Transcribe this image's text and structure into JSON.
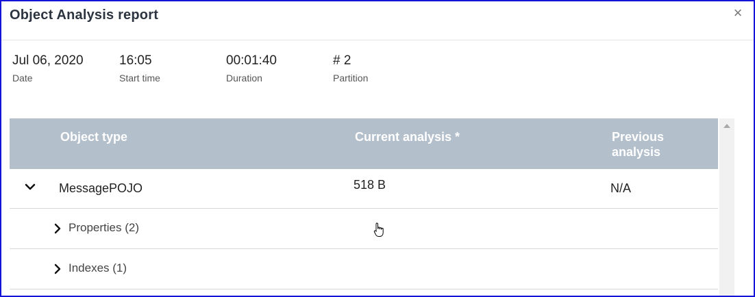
{
  "dialog": {
    "title": "Object Analysis report",
    "close_icon": "close-icon"
  },
  "stats": {
    "date": {
      "value": "Jul 06, 2020",
      "label": "Date"
    },
    "start_time": {
      "value": "16:05",
      "label": "Start time"
    },
    "duration": {
      "value": "00:01:40",
      "label": "Duration"
    },
    "partition": {
      "value": "# 2",
      "label": "Partition"
    }
  },
  "table": {
    "headers": {
      "object_type": "Object type",
      "current": "Current analysis *",
      "previous_line1": "Previous",
      "previous_line2": "analysis"
    },
    "rows": [
      {
        "object_type": "MessagePOJO",
        "current": "518 B",
        "previous": "N/A",
        "expanded": true
      }
    ],
    "sub_rows": [
      {
        "label": "Properties (2)"
      },
      {
        "label": "Indexes (1)"
      }
    ]
  },
  "colors": {
    "header_bg": "#b3bfcb",
    "frame_border": "#1414d8"
  }
}
